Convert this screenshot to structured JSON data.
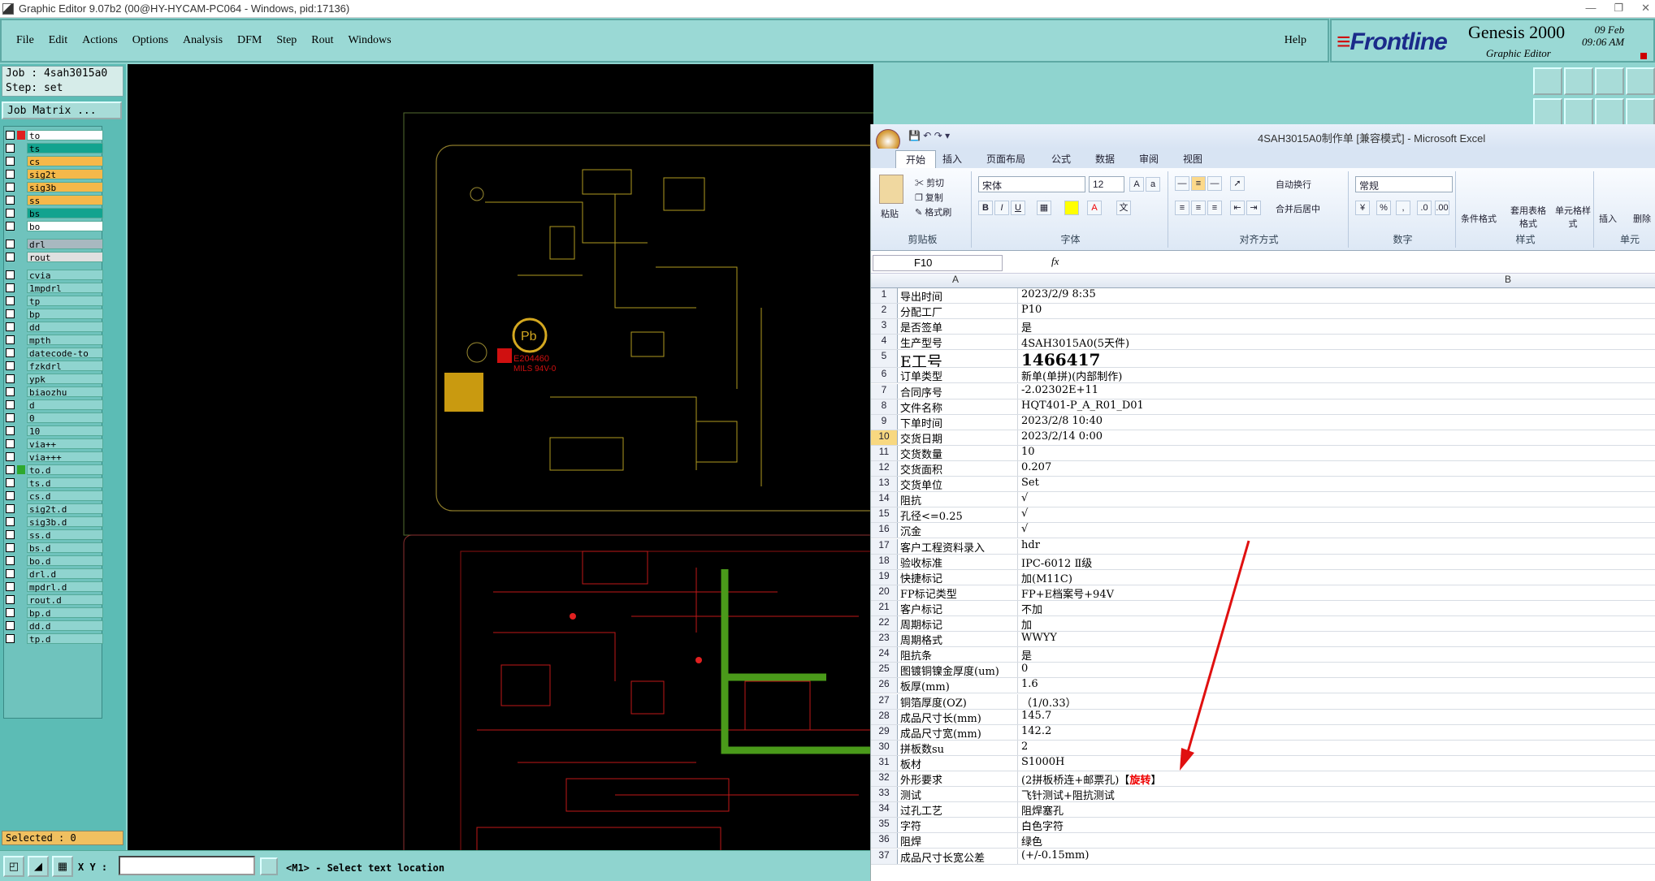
{
  "window": {
    "title": "Graphic Editor 9.07b2 (00@HY-HYCAM-PC064 - Windows, pid:17136)"
  },
  "menu": {
    "items": [
      "File",
      "Edit",
      "Actions",
      "Options",
      "Analysis",
      "DFM",
      "Step",
      "Rout",
      "Windows"
    ],
    "help": "Help"
  },
  "brand": {
    "logo": "Frontline",
    "product": "Genesis 2000",
    "subtitle": "Graphic Editor",
    "date": "09 Feb",
    "time": "09:06 AM"
  },
  "job": {
    "job_line": "Job : 4sah3015a0",
    "step_line": "Step: set",
    "matrix_button": "Job Matrix ..."
  },
  "layers": [
    {
      "name": "to",
      "swatch": "#e02020",
      "bg": "#ffffff"
    },
    {
      "name": "ts",
      "swatch": "",
      "bg": "#12a38f"
    },
    {
      "name": "cs",
      "swatch": "",
      "bg": "#f5b84a"
    },
    {
      "name": "sig2t",
      "swatch": "",
      "bg": "#f5b84a"
    },
    {
      "name": "sig3b",
      "swatch": "",
      "bg": "#f5b84a"
    },
    {
      "name": "ss",
      "swatch": "",
      "bg": "#f5b84a"
    },
    {
      "name": "bs",
      "swatch": "",
      "bg": "#12a38f"
    },
    {
      "name": "bo",
      "swatch": "",
      "bg": "#ffffff"
    },
    {
      "name": "drl",
      "swatch": "",
      "bg": "#a8b8c0"
    },
    {
      "name": "rout",
      "swatch": "",
      "bg": "#e0e0e0"
    },
    {
      "name": "cvia",
      "swatch": "",
      "bg": "#8fd4cf"
    },
    {
      "name": "1mpdrl",
      "swatch": "",
      "bg": "#8fd4cf"
    },
    {
      "name": "tp",
      "swatch": "",
      "bg": "#8fd4cf"
    },
    {
      "name": "bp",
      "swatch": "",
      "bg": "#8fd4cf"
    },
    {
      "name": "dd",
      "swatch": "",
      "bg": "#8fd4cf"
    },
    {
      "name": "mpth",
      "swatch": "",
      "bg": "#8fd4cf"
    },
    {
      "name": "datecode-to",
      "swatch": "",
      "bg": "#8fd4cf"
    },
    {
      "name": "fzkdrl",
      "swatch": "",
      "bg": "#8fd4cf"
    },
    {
      "name": "ypk",
      "swatch": "",
      "bg": "#8fd4cf"
    },
    {
      "name": "biaozhu",
      "swatch": "",
      "bg": "#8fd4cf"
    },
    {
      "name": "d",
      "swatch": "",
      "bg": "#8fd4cf"
    },
    {
      "name": "0",
      "swatch": "",
      "bg": "#8fd4cf"
    },
    {
      "name": "10",
      "swatch": "",
      "bg": "#8fd4cf"
    },
    {
      "name": "via++",
      "swatch": "",
      "bg": "#8fd4cf"
    },
    {
      "name": "via+++",
      "swatch": "",
      "bg": "#8fd4cf"
    },
    {
      "name": "to.d",
      "swatch": "#2ea82e",
      "bg": "#8fd4cf"
    },
    {
      "name": "ts.d",
      "swatch": "",
      "bg": "#8fd4cf"
    },
    {
      "name": "cs.d",
      "swatch": "",
      "bg": "#8fd4cf"
    },
    {
      "name": "sig2t.d",
      "swatch": "",
      "bg": "#8fd4cf"
    },
    {
      "name": "sig3b.d",
      "swatch": "",
      "bg": "#8fd4cf"
    },
    {
      "name": "ss.d",
      "swatch": "",
      "bg": "#8fd4cf"
    },
    {
      "name": "bs.d",
      "swatch": "",
      "bg": "#8fd4cf"
    },
    {
      "name": "bo.d",
      "swatch": "",
      "bg": "#8fd4cf"
    },
    {
      "name": "drl.d",
      "swatch": "",
      "bg": "#8fd4cf"
    },
    {
      "name": "mpdrl.d",
      "swatch": "",
      "bg": "#8fd4cf"
    },
    {
      "name": "rout.d",
      "swatch": "",
      "bg": "#8fd4cf"
    },
    {
      "name": "bp.d",
      "swatch": "",
      "bg": "#8fd4cf"
    },
    {
      "name": "dd.d",
      "swatch": "",
      "bg": "#8fd4cf"
    },
    {
      "name": "tp.d",
      "swatch": "",
      "bg": "#8fd4cf"
    }
  ],
  "selected": "Selected : 0",
  "bottom": {
    "xy_label": "X Y :",
    "xy_value": "",
    "status": "<M1> - Select text location"
  },
  "pcb": {
    "label1": "E204460",
    "label2": "MILS 94V-0",
    "pb": "Pb"
  },
  "excel": {
    "title": "4SAH3015A0制作单  [兼容模式] - Microsoft Excel",
    "tabs": [
      "开始",
      "插入",
      "页面布局",
      "公式",
      "数据",
      "审阅",
      "视图"
    ],
    "ribbon": {
      "paste": "粘贴",
      "cut": "剪切",
      "copy": "复制",
      "format_painter": "格式刷",
      "clipboard": "剪贴板",
      "font_name": "宋体",
      "font_size": "12",
      "font_group": "字体",
      "wrap": "自动换行",
      "merge": "合并后居中",
      "align_group": "对齐方式",
      "number_format": "常规",
      "number_group": "数字",
      "cond_format": "条件格式",
      "table_format": "套用表格格式",
      "cell_style": "单元格样式",
      "style_group": "样式",
      "insert": "插入",
      "delete": "删除",
      "cells_group": "单元"
    },
    "name_box": "F10",
    "fx": "fx",
    "col_a": "A",
    "col_b": "B",
    "rows": [
      {
        "n": "1",
        "a": "导出时间",
        "b": "2023/2/9 8:35"
      },
      {
        "n": "2",
        "a": "分配工厂",
        "b": "P10"
      },
      {
        "n": "3",
        "a": "是否签单",
        "b": "是"
      },
      {
        "n": "4",
        "a": "生产型号",
        "b": "4SAH3015A0(5天件)"
      },
      {
        "n": "5",
        "a": "E工号",
        "b": "1466417"
      },
      {
        "n": "6",
        "a": "订单类型",
        "b": "新单(单拼)(内部制作)"
      },
      {
        "n": "7",
        "a": "合同序号",
        "b": "-2.02302E+11"
      },
      {
        "n": "8",
        "a": "文件名称",
        "b": "HQT401-P_A_R01_D01"
      },
      {
        "n": "9",
        "a": "下单时间",
        "b": "2023/2/8 10:40"
      },
      {
        "n": "10",
        "a": "交货日期",
        "b": "2023/2/14 0:00"
      },
      {
        "n": "11",
        "a": "交货数量",
        "b": "10"
      },
      {
        "n": "12",
        "a": "交货面积",
        "b": "0.207"
      },
      {
        "n": "13",
        "a": "交货单位",
        "b": "Set"
      },
      {
        "n": "14",
        "a": "阻抗",
        "b": "√"
      },
      {
        "n": "15",
        "a": "孔径<=0.25",
        "b": "√"
      },
      {
        "n": "16",
        "a": "沉金",
        "b": "√"
      },
      {
        "n": "17",
        "a": "客户工程资料录入",
        "b": "hdr"
      },
      {
        "n": "18",
        "a": "验收标准",
        "b": "IPC-6012 Ⅱ级"
      },
      {
        "n": "19",
        "a": "快捷标记",
        "b": "加(M11C)"
      },
      {
        "n": "20",
        "a": "FP标记类型",
        "b": "FP+E档案号+94V"
      },
      {
        "n": "21",
        "a": "客户标记",
        "b": "不加"
      },
      {
        "n": "22",
        "a": "周期标记",
        "b": "加"
      },
      {
        "n": "23",
        "a": "周期格式",
        "b": "WWYY"
      },
      {
        "n": "24",
        "a": "阻抗条",
        "b": "是"
      },
      {
        "n": "25",
        "a": "图镀铜镍金厚度(um)",
        "b": "0"
      },
      {
        "n": "26",
        "a": "板厚(mm)",
        "b": "1.6"
      },
      {
        "n": "27",
        "a": "铜箔厚度(OZ)",
        "b": "（1/0.33）"
      },
      {
        "n": "28",
        "a": "成品尺寸长(mm)",
        "b": "145.7"
      },
      {
        "n": "29",
        "a": "成品尺寸宽(mm)",
        "b": "142.2"
      },
      {
        "n": "30",
        "a": "拼板数su",
        "b": "2"
      },
      {
        "n": "31",
        "a": "板材",
        "b": "S1000H"
      },
      {
        "n": "32",
        "a": "外形要求",
        "b": "(2拼板桥连+邮票孔)【",
        "b_red": "旋转",
        "b_end": "】"
      },
      {
        "n": "33",
        "a": "测试",
        "b": "飞针测试+阻抗测试"
      },
      {
        "n": "34",
        "a": "过孔工艺",
        "b": "阻焊塞孔"
      },
      {
        "n": "35",
        "a": "字符",
        "b": "白色字符"
      },
      {
        "n": "36",
        "a": "阻焊",
        "b": "绿色"
      },
      {
        "n": "37",
        "a": "成品尺寸长宽公差",
        "b": "(+/-0.15mm)"
      }
    ]
  }
}
